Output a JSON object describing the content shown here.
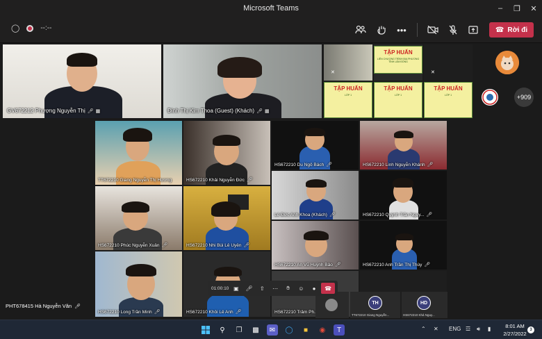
{
  "window": {
    "title": "Microsoft Teams"
  },
  "toolbar": {
    "meeting_timer": "--:--",
    "leave_label": "Rời đi"
  },
  "stage_top": [
    {
      "name": "GV672212 Phượng Nguyễn Thị"
    },
    {
      "name": "Đinh Thị Kim Thoa (Guest) (Khách)"
    }
  ],
  "banners": {
    "title": "TẬP HUẤN",
    "subtitle": "LIÊN CHƯƠNG TRÌNH ĐỊA PHƯƠNG TỈNH LÂM ĐỒNG",
    "grade": "LỚP 1"
  },
  "overflow_count": "+909",
  "gallery": [
    {
      "name": "TT672210 Giang Nguyễn Thị Hương"
    },
    {
      "name": "HS672210 Khải Nguyễn Đức"
    },
    {
      "name": "HS672210 Du Ngô Bách"
    },
    {
      "name": "HS672210 Linh Nguyễn Khánh"
    },
    {
      "name": "Lê Đức Anh Khoa (Khách)"
    },
    {
      "name": "HS672210 Quỳnh Trần Nguy..."
    },
    {
      "name": "HS672210 Phúc Nguyễn Xuân"
    },
    {
      "name": "HS672210 Nhi Bùi Lê Uyên"
    },
    {
      "name": "HS672210 An Vũ Huỳnh Bảo"
    },
    {
      "name": "HS672210 Anh Trần Thị Thùy"
    },
    {
      "name": "HS672210 Long Trần Minh"
    },
    {
      "name": "HS672210 Khôi Lê Anh"
    },
    {
      "name": "HS672210 Trâm Ph..."
    }
  ],
  "bottom_left": {
    "name": "PHT678415 Hà Nguyễn Văn"
  },
  "bottom_strip": [
    {
      "initials": "TH",
      "name": "TT672210 Giang Nguyễn..."
    },
    {
      "initials": "HD",
      "name": "HS672210 Khả Nguy..."
    }
  ],
  "callbar": {
    "timer": "01:00:10"
  },
  "taskbar": {
    "language": "ENG",
    "time": "8:01 AM",
    "date": "2/27/2022",
    "notifications": "3"
  }
}
